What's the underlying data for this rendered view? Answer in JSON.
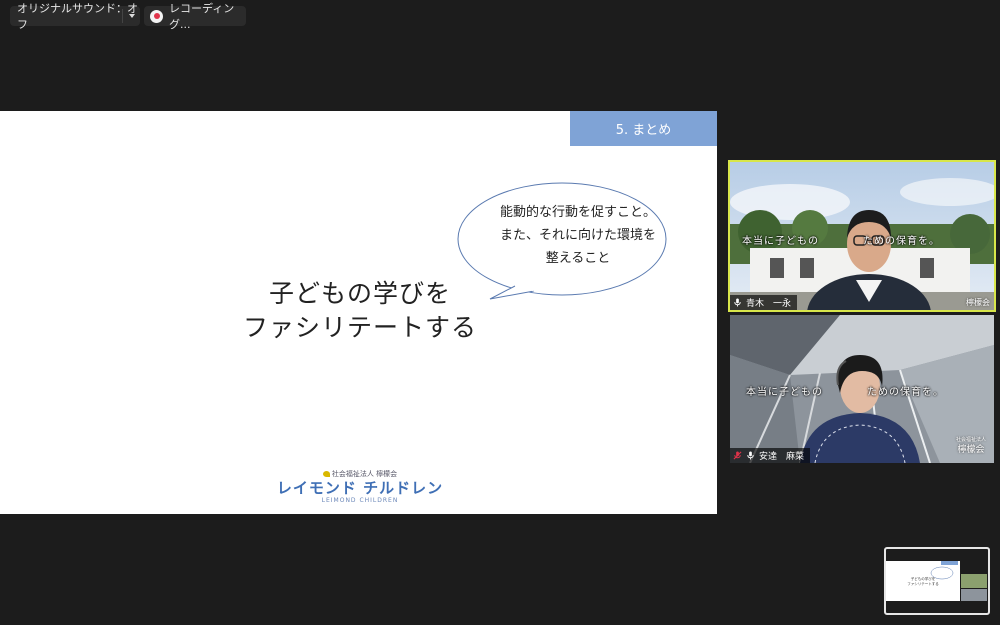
{
  "toolbar": {
    "audio_label": "オリジナルサウンド：オフ",
    "recording_label": "レコーディング..."
  },
  "slide": {
    "section_tag": "5. まとめ",
    "bubble_lines": [
      "能動的な行動を促すこと。",
      "また、それに向けた環境を",
      "整えること"
    ],
    "title_lines": [
      "子どもの学びを",
      "ファシリテートする"
    ],
    "logo": {
      "top": "社会福祉法人 檸檬会",
      "main": "レイモンド チルドレン",
      "en": "LEIMOND CHILDREN"
    }
  },
  "participants": [
    {
      "name": "青木　一永",
      "overlay": "本当に子どもの　　　　ための保育を。",
      "corner": "檸檬会"
    },
    {
      "name": "安達　麻菜",
      "overlay": "本当に子どもの　　　　ための保育を。",
      "corner_small": "社会福祉法人",
      "corner": "檸檬会"
    }
  ],
  "mini_preview": {
    "title_lines": [
      "子どもの学びを",
      "ファシリテートする"
    ]
  },
  "colors": {
    "active_speaker_border": "#d8e64a",
    "section_tag": "#7fa3d6",
    "record_dot": "#e0334a"
  }
}
